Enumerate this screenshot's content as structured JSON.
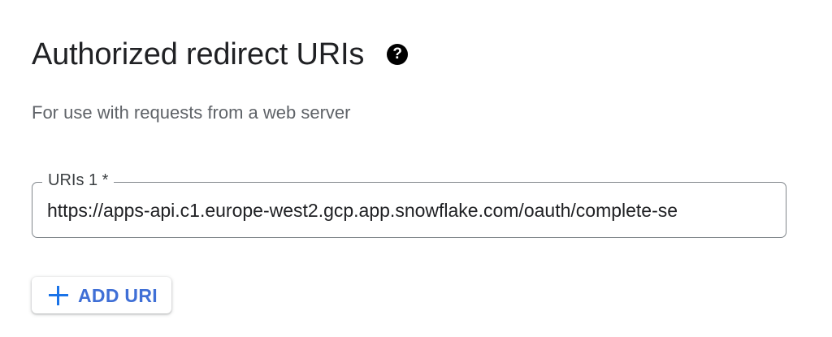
{
  "section": {
    "title": "Authorized redirect URIs",
    "help_icon": "help-icon",
    "subtitle": "For use with requests from a web server"
  },
  "uri_field": {
    "label": "URIs 1 *",
    "value": "https://apps-api.c1.europe-west2.gcp.app.snowflake.com/oauth/complete-se"
  },
  "add_button": {
    "icon": "plus-icon",
    "label": "ADD URI"
  },
  "colors": {
    "accent": "#1a73e8",
    "text": "#202124",
    "muted_text": "#5f6368",
    "border": "#80868b"
  }
}
